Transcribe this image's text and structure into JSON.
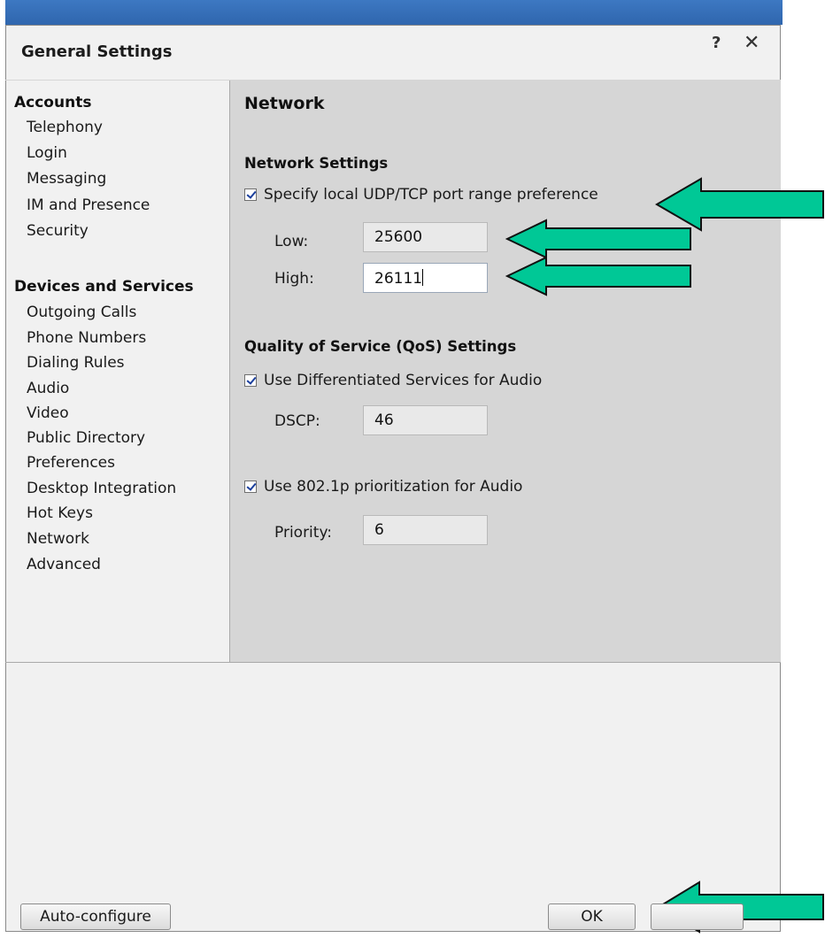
{
  "dialog": {
    "title": "General Settings",
    "help_label": "?",
    "close_label": "✕"
  },
  "sidebar": {
    "groups": [
      {
        "label": "Accounts",
        "items": [
          "Telephony",
          "Login",
          "Messaging",
          "IM and Presence",
          "Security"
        ]
      },
      {
        "label": "Devices and Services",
        "items": [
          "Outgoing Calls",
          "Phone Numbers",
          "Dialing Rules",
          "Audio",
          "Video",
          "Public Directory",
          "Preferences",
          "Desktop Integration",
          "Hot Keys",
          "Network",
          "Advanced"
        ]
      }
    ]
  },
  "main": {
    "title": "Network",
    "network_settings": {
      "heading": "Network Settings",
      "port_range_checkbox": {
        "label": "Specify local UDP/TCP port range preference",
        "checked": true
      },
      "low": {
        "label": "Low:",
        "value": "25600"
      },
      "high": {
        "label": "High:",
        "value": "26111"
      }
    },
    "qos_settings": {
      "heading": "Quality of Service (QoS) Settings",
      "diffserv_checkbox": {
        "label": "Use Differentiated Services for Audio",
        "checked": true
      },
      "dscp": {
        "label": "DSCP:",
        "value": "46"
      },
      "prioritization_checkbox": {
        "label": "Use 802.1p prioritization for Audio",
        "checked": true
      },
      "priority": {
        "label": "Priority:",
        "value": "6"
      }
    }
  },
  "footer": {
    "autoconfigure_label": "Auto-configure",
    "ok_label": "OK"
  },
  "colors": {
    "arrow_fill": "#00c896",
    "panel_bg": "#d6d6d6",
    "title_bar": "#3d78c2"
  }
}
